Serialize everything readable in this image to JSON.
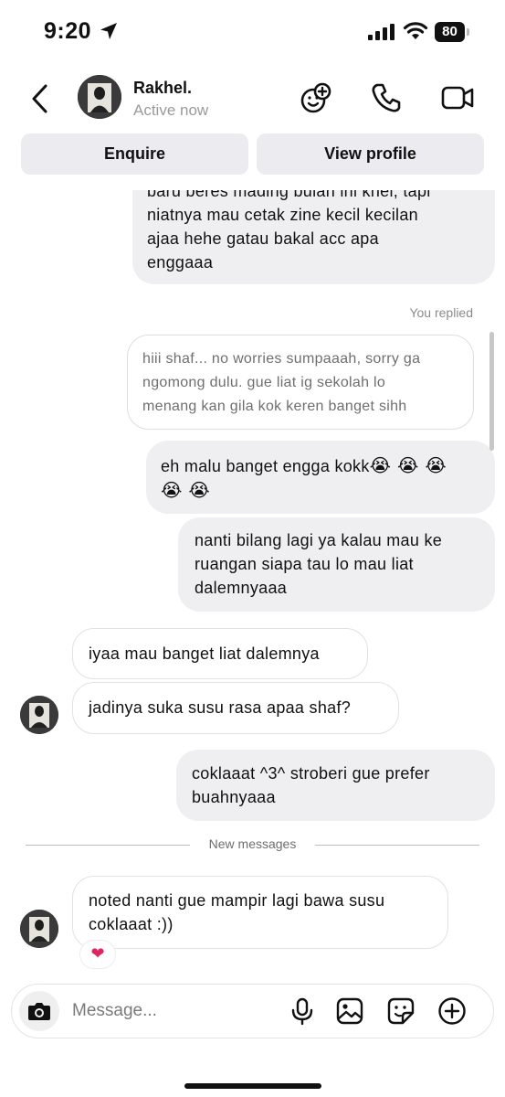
{
  "status_bar": {
    "time": "9:20",
    "battery": "80"
  },
  "header": {
    "contact_name": "Rakhel.",
    "contact_status": "Active now",
    "icons": [
      "back-icon",
      "effects-icon",
      "phone-icon",
      "video-camera-icon"
    ]
  },
  "actions": {
    "enquire": "Enquire",
    "view_profile": "View profile"
  },
  "messages": {
    "m1_line1": "baru beres mading bulan ini khel, tapi",
    "m1_line2": "niatnya mau cetak zine kecil kecilan",
    "m1_line3": "ajaa hehe gatau bakal acc apa",
    "m1_line4": "enggaaa",
    "replied_label": "You replied",
    "quote_line1": "hiii shaf... no worries sumpaaah, sorry ga",
    "quote_line2": "ngomong dulu. gue liat ig sekolah lo",
    "quote_line3": "menang kan gila kok keren banget sihh",
    "m2_line1": "eh malu banget engga kokk",
    "m2_emoji_line1": "😭 😭 😭",
    "m2_emoji_line2": "😭 😭",
    "m3_line1": "nanti bilang lagi ya kalau mau ke",
    "m3_line2": "ruangan siapa tau lo mau liat",
    "m3_line3": "dalemnyaaa",
    "r1": "iyaa mau banget liat dalemnya",
    "r2": "jadinya suka susu rasa apaa shaf?",
    "m4_line1": "coklaaat ^3^ stroberi gue prefer",
    "m4_line2": "buahnyaaa",
    "divider": "New messages",
    "r3_line1": "noted nanti gue mampir lagi bawa susu",
    "r3_line2": "coklaaat :))",
    "reaction": "❤"
  },
  "composer": {
    "placeholder": "Message...",
    "icons": [
      "camera-icon",
      "microphone-icon",
      "photo-icon",
      "sticker-icon",
      "plus-icon"
    ]
  },
  "colors": {
    "bubble": "#efeff1",
    "muted_text": "#9a9a9a",
    "reaction": "#e0245e"
  }
}
